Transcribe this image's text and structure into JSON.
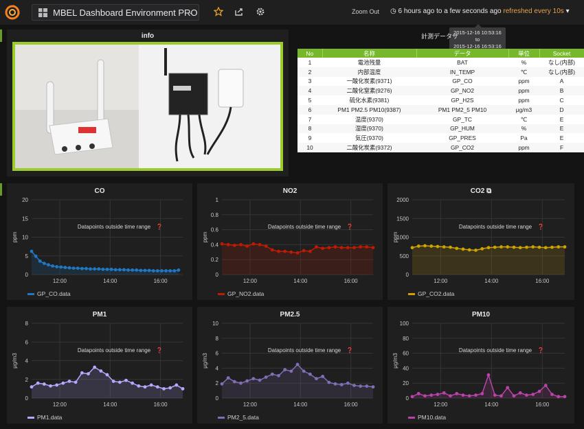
{
  "topnav": {
    "dashboard_title": "MBEL Dashboard Environment PRO",
    "zoom_out_label": "Zoom Out",
    "time_range_label": "6 hours ago to a few seconds ago",
    "refresh_label": "refreshed every 10s",
    "tooltip_from": "2015-12-16 10:53:16",
    "tooltip_to_word": "to",
    "tooltip_to": "2015-12-16 16:53:16"
  },
  "info_panel": {
    "title": "info"
  },
  "sensor_table": {
    "title": "計測データサ",
    "headers": [
      "No",
      "名称",
      "データ",
      "単位",
      "Socket"
    ],
    "rows": [
      [
        "1",
        "電池残量",
        "BAT",
        "%",
        "なし(内部)"
      ],
      [
        "2",
        "内部温度",
        "IN_TEMP",
        "℃",
        "なし(内部)"
      ],
      [
        "3",
        "一酸化炭素(9371)",
        "GP_CO",
        "ppm",
        "A"
      ],
      [
        "4",
        "二酸化窒素(9276)",
        "GP_NO2",
        "ppm",
        "B"
      ],
      [
        "5",
        "硫化水素(9381)",
        "GP_H2S",
        "ppm",
        "C"
      ],
      [
        "6",
        "PM1 PM2.5 PM10(9387)",
        "PM1 PM2_5 PM10",
        "μg/m3",
        "D"
      ],
      [
        "7",
        "温度(9370)",
        "GP_TC",
        "℃",
        "E"
      ],
      [
        "8",
        "湿度(9370)",
        "GP_HUM",
        "%",
        "E"
      ],
      [
        "9",
        "気圧(9370)",
        "GP_PRES",
        "Pa",
        "E"
      ],
      [
        "10",
        "二酸化炭素(9372)",
        "GP_CO2",
        "ppm",
        "F"
      ]
    ]
  },
  "overlay_text": "Datapoints outside time range",
  "chart_data": [
    {
      "type": "line",
      "title": "CO",
      "ylabel": "ppm",
      "ylim": [
        0,
        20
      ],
      "yticks": [
        0,
        5,
        10,
        15,
        20
      ],
      "x": [
        "10:53",
        "11:03",
        "11:13",
        "11:23",
        "11:33",
        "11:43",
        "11:53",
        "12:03",
        "12:13",
        "12:23",
        "12:33",
        "12:43",
        "12:53",
        "13:03",
        "13:13",
        "13:23",
        "13:33",
        "13:43",
        "13:53",
        "14:03",
        "14:13",
        "14:23",
        "14:33",
        "14:43",
        "14:53",
        "15:03",
        "15:13",
        "15:23",
        "15:33",
        "15:43",
        "15:53",
        "16:03",
        "16:13",
        "16:23",
        "16:33",
        "16:43"
      ],
      "xticks": [
        "12:00",
        "14:00",
        "16:00"
      ],
      "series": [
        {
          "name": "GP_CO.data",
          "color": "#1f78c1",
          "values": [
            6.2,
            4.9,
            3.6,
            3.0,
            2.6,
            2.3,
            2.1,
            2.0,
            1.9,
            1.8,
            1.7,
            1.7,
            1.6,
            1.6,
            1.5,
            1.5,
            1.5,
            1.4,
            1.4,
            1.4,
            1.3,
            1.3,
            1.3,
            1.2,
            1.2,
            1.2,
            1.1,
            1.1,
            1.1,
            1.0,
            1.0,
            1.0,
            1.0,
            1.0,
            1.0,
            1.2
          ]
        }
      ]
    },
    {
      "type": "line",
      "title": "NO2",
      "ylabel": "ppm",
      "ylim": [
        0,
        1.0
      ],
      "yticks": [
        0,
        0.2,
        0.4,
        0.6,
        0.8,
        1.0
      ],
      "x": [
        "10:53",
        "11:08",
        "11:23",
        "11:38",
        "11:53",
        "12:08",
        "12:23",
        "12:38",
        "12:53",
        "13:08",
        "13:23",
        "13:38",
        "13:53",
        "14:08",
        "14:23",
        "14:38",
        "14:53",
        "15:08",
        "15:23",
        "15:38",
        "15:53",
        "16:08",
        "16:23",
        "16:38",
        "16:53"
      ],
      "xticks": [
        "12:00",
        "14:00",
        "16:00"
      ],
      "series": [
        {
          "name": "GP_NO2.data",
          "color": "#bf1b00",
          "values": [
            0.41,
            0.4,
            0.39,
            0.4,
            0.38,
            0.41,
            0.4,
            0.38,
            0.33,
            0.31,
            0.31,
            0.3,
            0.29,
            0.32,
            0.31,
            0.37,
            0.35,
            0.36,
            0.37,
            0.36,
            0.36,
            0.36,
            0.37,
            0.37,
            0.36
          ]
        }
      ]
    },
    {
      "type": "line",
      "title": "CO2",
      "ylabel": "ppm",
      "ylim": [
        0,
        2000
      ],
      "yticks": [
        0,
        500,
        1000,
        1500,
        2000
      ],
      "x": [
        "10:53",
        "11:08",
        "11:23",
        "11:38",
        "11:53",
        "12:08",
        "12:23",
        "12:38",
        "12:53",
        "13:08",
        "13:23",
        "13:38",
        "13:53",
        "14:08",
        "14:23",
        "14:38",
        "14:53",
        "15:08",
        "15:23",
        "15:38",
        "15:53",
        "16:08",
        "16:23",
        "16:38",
        "16:53"
      ],
      "xticks": [
        "12:00",
        "14:00",
        "16:00"
      ],
      "series": [
        {
          "name": "GP_CO2.data",
          "color": "#cca300",
          "values": [
            720,
            760,
            770,
            760,
            750,
            740,
            730,
            700,
            680,
            660,
            650,
            690,
            720,
            730,
            740,
            740,
            730,
            720,
            730,
            740,
            730,
            720,
            730,
            740,
            740
          ]
        }
      ]
    },
    {
      "type": "line",
      "title": "PM1",
      "ylabel": "μg/m3",
      "ylim": [
        0,
        8
      ],
      "yticks": [
        0,
        2,
        4,
        6,
        8
      ],
      "x": [
        "10:53",
        "11:08",
        "11:23",
        "11:38",
        "11:53",
        "12:08",
        "12:23",
        "12:38",
        "12:53",
        "13:08",
        "13:23",
        "13:38",
        "13:53",
        "14:08",
        "14:23",
        "14:38",
        "14:53",
        "15:08",
        "15:23",
        "15:38",
        "15:53",
        "16:08",
        "16:23",
        "16:38",
        "16:53"
      ],
      "xticks": [
        "12:00",
        "14:00",
        "16:00"
      ],
      "series": [
        {
          "name": "PM1.data",
          "color": "#b7a8ff",
          "values": [
            1.2,
            1.6,
            1.5,
            1.3,
            1.4,
            1.6,
            1.8,
            1.7,
            2.7,
            2.6,
            3.3,
            2.9,
            2.5,
            1.8,
            1.7,
            1.9,
            1.6,
            1.3,
            1.2,
            1.4,
            1.2,
            1.0,
            1.1,
            1.4,
            1.0
          ]
        }
      ]
    },
    {
      "type": "line",
      "title": "PM2.5",
      "ylabel": "μg/m3",
      "ylim": [
        0,
        10
      ],
      "yticks": [
        0,
        2,
        4,
        6,
        8,
        10
      ],
      "x": [
        "10:53",
        "11:08",
        "11:23",
        "11:38",
        "11:53",
        "12:08",
        "12:23",
        "12:38",
        "12:53",
        "13:08",
        "13:23",
        "13:38",
        "13:53",
        "14:08",
        "14:23",
        "14:38",
        "14:53",
        "15:08",
        "15:23",
        "15:38",
        "15:53",
        "16:08",
        "16:23",
        "16:38",
        "16:53"
      ],
      "xticks": [
        "12:00",
        "14:00",
        "16:00"
      ],
      "series": [
        {
          "name": "PM2_5.data",
          "color": "#806eb7",
          "values": [
            1.9,
            2.7,
            2.2,
            2.0,
            2.3,
            2.6,
            2.4,
            2.8,
            3.2,
            3.0,
            3.8,
            3.6,
            4.5,
            3.6,
            3.2,
            2.6,
            2.9,
            2.1,
            1.9,
            1.8,
            2.0,
            1.7,
            1.6,
            1.6,
            1.5
          ]
        }
      ]
    },
    {
      "type": "line",
      "title": "PM10",
      "ylabel": "μg/m3",
      "ylim": [
        0,
        100
      ],
      "yticks": [
        0,
        20,
        40,
        60,
        80,
        100
      ],
      "x": [
        "10:53",
        "11:08",
        "11:23",
        "11:38",
        "11:53",
        "12:08",
        "12:23",
        "12:38",
        "12:53",
        "13:08",
        "13:23",
        "13:38",
        "13:53",
        "14:08",
        "14:23",
        "14:38",
        "14:53",
        "15:08",
        "15:23",
        "15:38",
        "15:53",
        "16:08",
        "16:23",
        "16:38",
        "16:53"
      ],
      "xticks": [
        "12:00",
        "14:00",
        "16:00"
      ],
      "series": [
        {
          "name": "PM10.data",
          "color": "#ba43a9",
          "values": [
            2,
            6,
            3,
            4,
            5,
            7,
            3,
            6,
            4,
            3,
            4,
            6,
            31,
            4,
            3,
            14,
            3,
            7,
            4,
            5,
            9,
            17,
            5,
            2,
            2
          ]
        }
      ]
    }
  ]
}
